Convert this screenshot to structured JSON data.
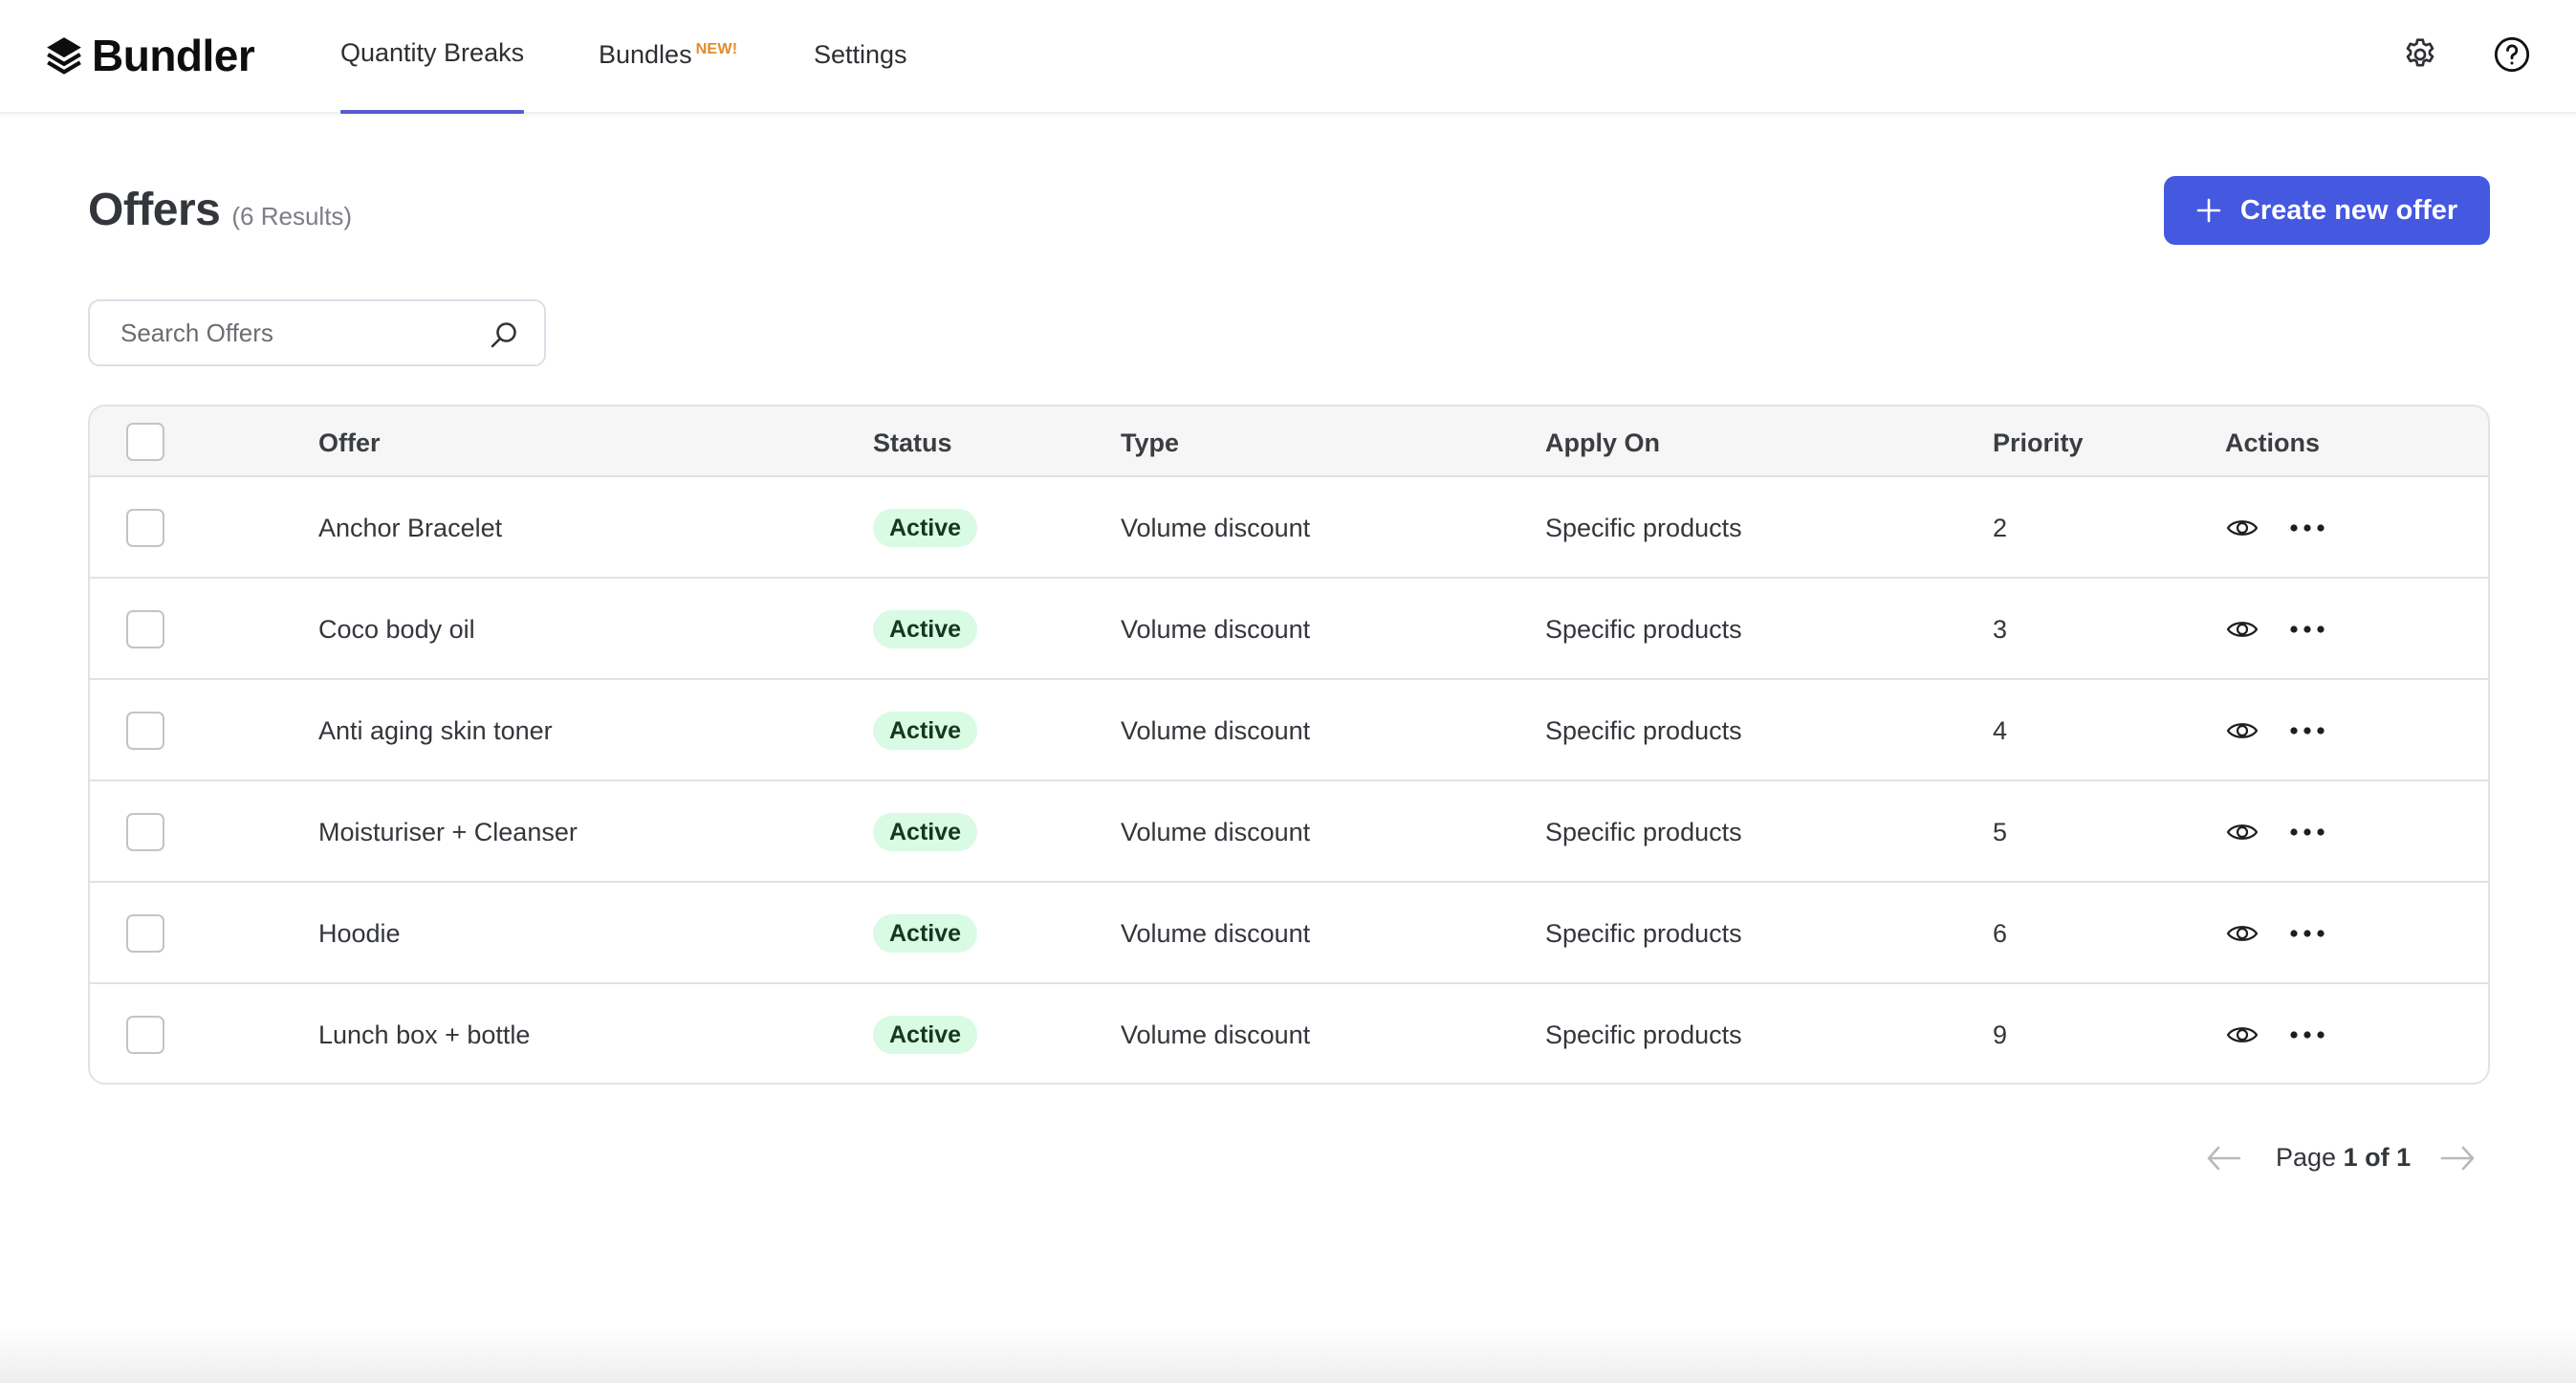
{
  "app": {
    "name": "Bundler"
  },
  "nav": {
    "items": [
      {
        "label": "Quantity Breaks",
        "active": true
      },
      {
        "label": "Bundles",
        "badge": "NEW!",
        "active": false
      },
      {
        "label": "Settings",
        "active": false
      }
    ],
    "icons": [
      "gear-icon",
      "help-icon"
    ]
  },
  "page": {
    "title": "Offers",
    "results": "(6 Results)",
    "create_button": "Create new offer"
  },
  "search": {
    "placeholder": "Search Offers",
    "value": ""
  },
  "table": {
    "columns": [
      "Offer",
      "Status",
      "Type",
      "Apply On",
      "Priority",
      "Actions"
    ],
    "rows": [
      {
        "offer": "Anchor Bracelet",
        "status": "Active",
        "type": "Volume discount",
        "apply_on": "Specific products",
        "priority": "2"
      },
      {
        "offer": "Coco body oil",
        "status": "Active",
        "type": "Volume discount",
        "apply_on": "Specific products",
        "priority": "3"
      },
      {
        "offer": "Anti aging skin toner",
        "status": "Active",
        "type": "Volume discount",
        "apply_on": "Specific products",
        "priority": "4"
      },
      {
        "offer": "Moisturiser + Cleanser",
        "status": "Active",
        "type": "Volume discount",
        "apply_on": "Specific products",
        "priority": "5"
      },
      {
        "offer": "Hoodie",
        "status": "Active",
        "type": "Volume discount",
        "apply_on": "Specific products",
        "priority": "6"
      },
      {
        "offer": "Lunch box + bottle",
        "status": "Active",
        "type": "Volume discount",
        "apply_on": "Specific products",
        "priority": "9"
      }
    ]
  },
  "pagination": {
    "prefix": "Page",
    "current": "1 of 1"
  },
  "colors": {
    "accent": "#4458e0",
    "nav_underline": "#5a5bd5",
    "new_badge": "#e58a2a",
    "status_active_bg": "#d9fbe3",
    "status_active_text": "#17361f"
  }
}
